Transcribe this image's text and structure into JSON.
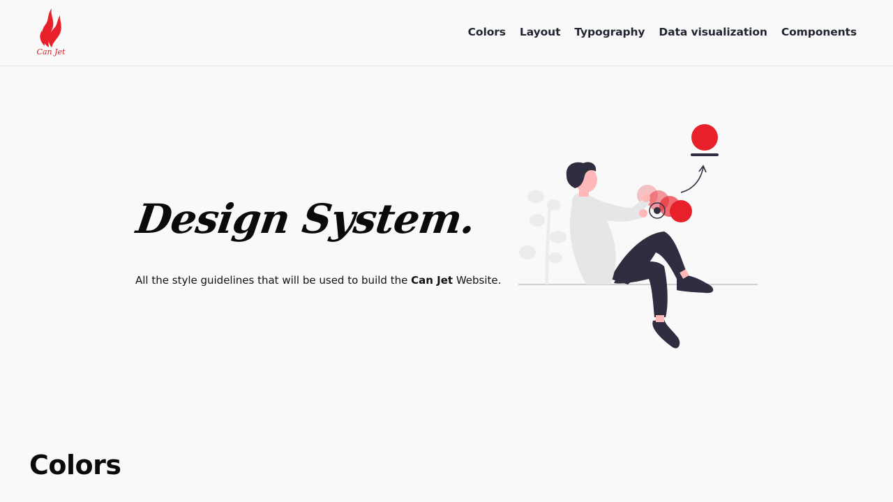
{
  "brand": {
    "logo_text": "Can Jet",
    "accent_color": "#e8202a"
  },
  "nav": {
    "items": [
      {
        "label": "Colors"
      },
      {
        "label": "Layout"
      },
      {
        "label": "Typography"
      },
      {
        "label": "Data visualization"
      },
      {
        "label": "Components"
      }
    ]
  },
  "hero": {
    "title": "Design System.",
    "subtitle_before": "All the style guidelines that will be used to build the ",
    "subtitle_brand": "Can Jet",
    "subtitle_after": " Website."
  },
  "sections": {
    "colors_heading": "Colors"
  },
  "icons": {
    "logo": "flame-logo-icon",
    "illustration": "person-design-illustration"
  }
}
